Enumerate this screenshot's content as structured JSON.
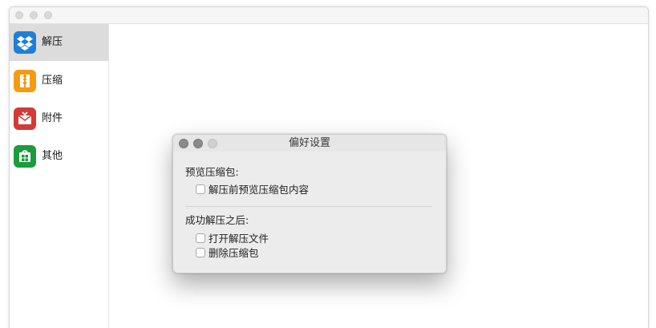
{
  "sidebar": {
    "items": [
      {
        "label": "解压",
        "icon": "dropbox-icon",
        "color": "#1d7fd6",
        "selected": true
      },
      {
        "label": "压缩",
        "icon": "archive-icon",
        "color": "#f39c12",
        "selected": false
      },
      {
        "label": "附件",
        "icon": "mail-attachment-icon",
        "color": "#d23b36",
        "selected": false
      },
      {
        "label": "其他",
        "icon": "box-icon",
        "color": "#1c9c3c",
        "selected": false
      }
    ]
  },
  "dialog": {
    "title": "偏好设置",
    "preview_section": {
      "label": "预览压缩包:",
      "options": [
        {
          "label": "解压前预览压缩包内容",
          "checked": false
        }
      ]
    },
    "after_section": {
      "label": "成功解压之后:",
      "options": [
        {
          "label": "打开解压文件",
          "checked": false
        },
        {
          "label": "删除压缩包",
          "checked": false
        }
      ]
    }
  },
  "colors": {
    "sidebar_selected": "#dcdcdc",
    "dialog_bg": "#ececec"
  }
}
